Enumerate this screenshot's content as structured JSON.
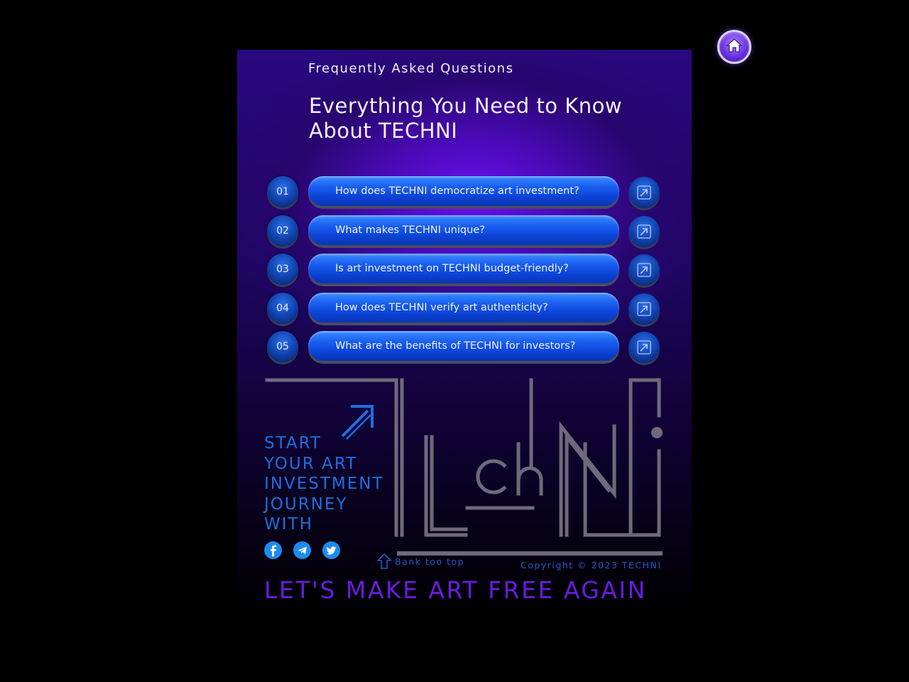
{
  "home": {
    "label": "home-icon"
  },
  "header": {
    "eyebrow": "Frequently Asked Questions",
    "title_line1": "Everything You Need to Know",
    "title_line2": "About TECHNI"
  },
  "faq": [
    {
      "num": "01",
      "question": "How does TECHNI democratize art investment?"
    },
    {
      "num": "02",
      "question": "What makes TECHNI unique?"
    },
    {
      "num": "03",
      "question": "Is art investment on TECHNI budget-friendly?"
    },
    {
      "num": "04",
      "question": "How does TECHNI verify art authenticity?"
    },
    {
      "num": "05",
      "question": "What are the benefits of TECHNI for investors?"
    }
  ],
  "cta": {
    "line1": "START",
    "line2": "YOUR ART",
    "line3": "INVESTMENT",
    "line4": "JOURNEY",
    "line5": "WITH"
  },
  "social": [
    "facebook-icon",
    "telegram-icon",
    "twitter-icon"
  ],
  "footer": {
    "back_top": "Bank too top",
    "copyright": "Copyright © 2023 TECHNI",
    "tagline": "LET'S MAKE ART FREE AGAIN"
  },
  "colors": {
    "accent_blue": "#1a5ff0",
    "cta_blue": "#1f6ee0",
    "tagline_purple": "#6a1be0",
    "logo_grey": "#6e6a7a"
  }
}
